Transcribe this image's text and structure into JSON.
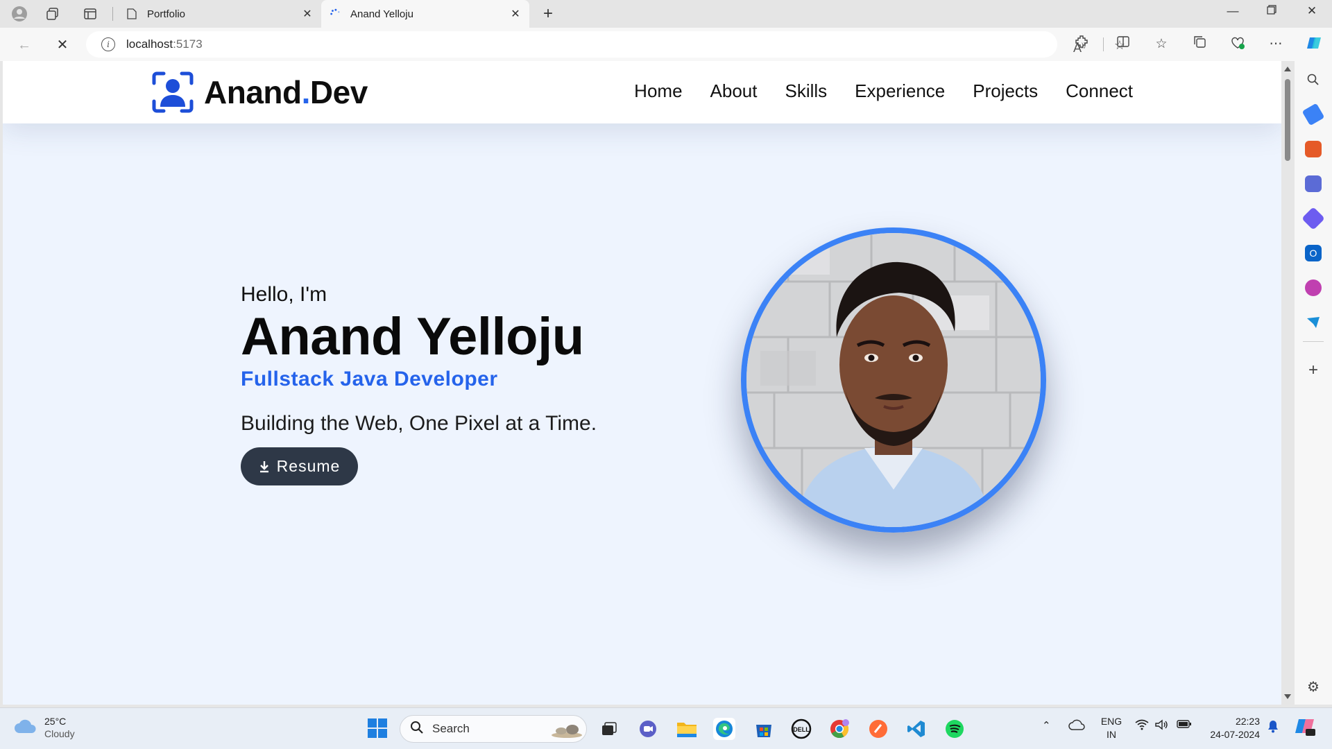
{
  "browser": {
    "tabs": [
      {
        "label": "Portfolio",
        "state": "inactive"
      },
      {
        "label": "Anand Yelloju",
        "state": "active-loading"
      }
    ],
    "url_host": "localhost",
    "url_port": ":5173"
  },
  "site": {
    "logo": {
      "name": "Anand",
      "dot": ".",
      "suffix": "Dev"
    },
    "nav": [
      "Home",
      "About",
      "Skills",
      "Experience",
      "Projects",
      "Connect"
    ],
    "hero": {
      "greeting": "Hello, I'm",
      "name": "Anand Yelloju",
      "role": "Fullstack Java Developer",
      "tagline": "Building the Web, One Pixel at a Time.",
      "resume_label": "Resume"
    },
    "colors": {
      "accent": "#2563eb",
      "ring": "#3b82f6",
      "button": "#2e3847",
      "background": "#eef4fe"
    }
  },
  "taskbar": {
    "weather": {
      "temp": "25°C",
      "condition": "Cloudy"
    },
    "search_label": "Search",
    "lang": {
      "line1": "ENG",
      "line2": "IN"
    },
    "clock": {
      "time": "22:23",
      "date": "24-07-2024"
    }
  }
}
